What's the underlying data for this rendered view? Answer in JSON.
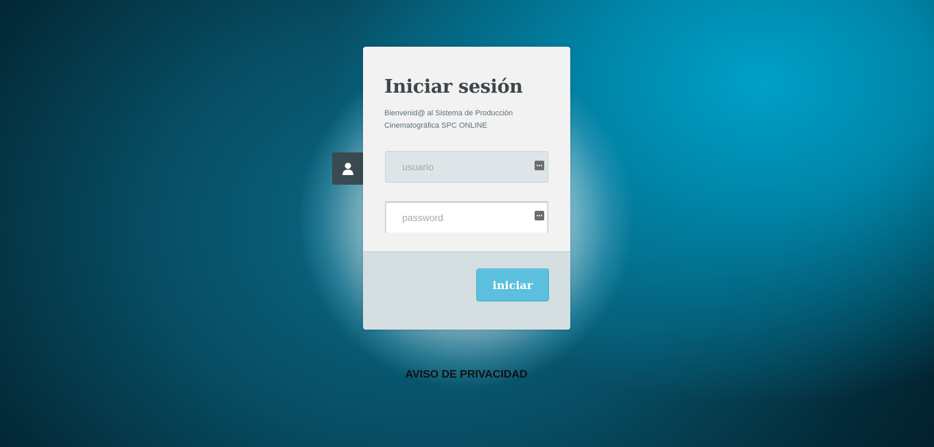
{
  "login": {
    "title": "Iniciar sesión",
    "subtitle": "Bienvenid@ al Sistema de Producción Cinematográfica SPC ONLINE",
    "username": {
      "value": "",
      "placeholder": "usuario"
    },
    "password": {
      "value": "",
      "placeholder": "password"
    },
    "submit_label": "iniciar"
  },
  "footer": {
    "privacy_label": "AVISO DE PRIVACIDAD"
  },
  "icons": {
    "side": "user-icon",
    "field_key": "password-manager-key-icon"
  },
  "colors": {
    "button": "#5bc0de",
    "card": "#f2f2f2",
    "card_footer": "#d5dfe1",
    "side_icon_bg": "#3a4a51",
    "background_accent": "#00a0c8"
  }
}
